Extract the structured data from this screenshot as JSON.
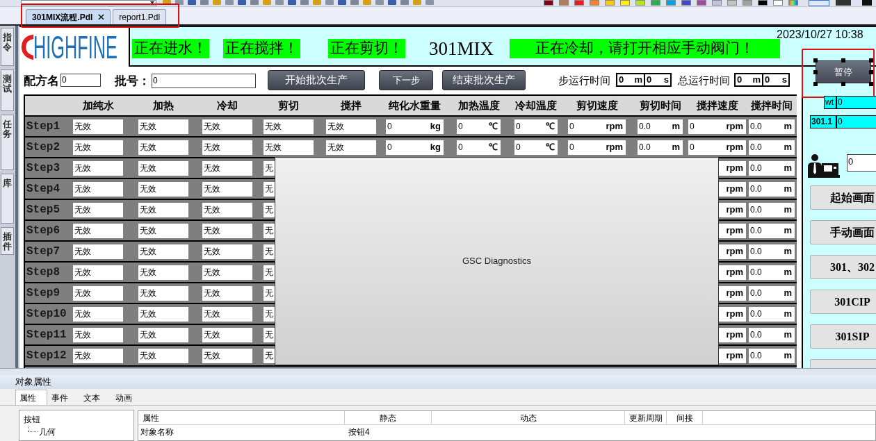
{
  "toolbar": {
    "palette": [
      {
        "color": "#880015"
      },
      {
        "color": "#b97a57"
      },
      {
        "color": "#ed1c24"
      },
      {
        "color": "#ff7f27"
      },
      {
        "color": "#ffc90e"
      },
      {
        "color": "#fff200"
      },
      {
        "color": "#b5e61d"
      },
      {
        "color": "#22b14c"
      },
      {
        "color": "#00a2e8"
      },
      {
        "color": "#3f48cc"
      },
      {
        "color": "#a349a4"
      },
      {
        "color": "#c8bfe7"
      },
      {
        "color": "#c3c3c3"
      },
      {
        "color": "#a0a0a0"
      },
      {
        "color": "#000000"
      },
      {
        "color": "#ffffff"
      }
    ]
  },
  "tabs": [
    {
      "label": "301MIX流程.Pdl",
      "closable": true,
      "selected": true
    },
    {
      "label": "report1.Pdl",
      "closable": false,
      "selected": false
    }
  ],
  "side_tabs": [
    {
      "label": "指令"
    },
    {
      "label": "测试"
    },
    {
      "label": "任务"
    },
    {
      "label": "库"
    },
    {
      "label": "插件"
    }
  ],
  "picture": {
    "logo": "HIGHFINE",
    "banner": [
      {
        "kind": "alert",
        "text": "正在进水！"
      },
      {
        "kind": "alert",
        "text": "正在搅拌！"
      },
      {
        "kind": "alert",
        "text": "正在剪切！"
      },
      {
        "kind": "title",
        "text": "301MIX"
      },
      {
        "kind": "alert",
        "text": "正在冷却，请打开相应手动阀门！"
      }
    ],
    "datetime": "2023/10/27 10:38",
    "recipe": {
      "label": "配方名",
      "value": "0"
    },
    "batch": {
      "label": "批号：",
      "value": "0"
    },
    "buttons": [
      "开始批次生产",
      "下一步",
      "结束批次生产"
    ],
    "timers": [
      {
        "label": "步运行时间",
        "minutes": "0",
        "minute_unit": "m",
        "seconds": "0",
        "second_unit": "s"
      },
      {
        "label": "总运行时间",
        "minutes": "0",
        "minute_unit": "m",
        "seconds": "0",
        "second_unit": "s"
      }
    ],
    "table": {
      "columns": [
        "加纯水",
        "加热",
        "冷却",
        "剪切",
        "搅拌",
        "纯化水重量",
        "加热温度",
        "冷却温度",
        "剪切速度",
        "剪切时间",
        "搅拌速度",
        "搅拌时间"
      ],
      "rows": [
        {
          "label": "Step1",
          "cells": [
            {
              "value": "无效"
            },
            {
              "value": "无效"
            },
            {
              "value": "无效"
            },
            {
              "value": "无效"
            },
            {
              "value": "无效"
            },
            {
              "value": "0",
              "unit": "kg"
            },
            {
              "value": "0",
              "unit": "℃"
            },
            {
              "value": "0",
              "unit": "℃"
            },
            {
              "value": "0",
              "unit": "rpm"
            },
            {
              "value": "0.0",
              "unit": "m"
            },
            {
              "value": "0",
              "unit": "rpm"
            },
            {
              "value": "0.0",
              "unit": "m"
            }
          ]
        },
        {
          "label": "Step2",
          "cells": [
            {
              "value": "无效"
            },
            {
              "value": "无效"
            },
            {
              "value": "无效"
            },
            {
              "value": "无效"
            },
            {
              "value": "无效"
            },
            {
              "value": "0",
              "unit": "kg"
            },
            {
              "value": "0",
              "unit": "℃"
            },
            {
              "value": "0",
              "unit": "℃"
            },
            {
              "value": "0",
              "unit": "rpm"
            },
            {
              "value": "0.0",
              "unit": "m"
            },
            {
              "value": "0",
              "unit": "rpm"
            },
            {
              "value": "0.0",
              "unit": "m"
            }
          ]
        },
        {
          "label": "Step3",
          "left_cells": [
            {
              "value": "无效"
            },
            {
              "value": "无效"
            },
            {
              "value": "无效"
            },
            {
              "value": "无"
            }
          ],
          "right_cells": [
            {
              "unit": "rpm"
            },
            {
              "value": "0.0",
              "unit": "m"
            }
          ]
        },
        {
          "label": "Step4",
          "left_cells": [
            {
              "value": "无效"
            },
            {
              "value": "无效"
            },
            {
              "value": "无效"
            },
            {
              "value": "无"
            }
          ],
          "right_cells": [
            {
              "unit": "rpm"
            },
            {
              "value": "0.0",
              "unit": "m"
            }
          ]
        },
        {
          "label": "Step5",
          "left_cells": [
            {
              "value": "无效"
            },
            {
              "value": "无效"
            },
            {
              "value": "无效"
            },
            {
              "value": "无"
            }
          ],
          "right_cells": [
            {
              "unit": "rpm"
            },
            {
              "value": "0.0",
              "unit": "m"
            }
          ]
        },
        {
          "label": "Step6",
          "left_cells": [
            {
              "value": "无效"
            },
            {
              "value": "无效"
            },
            {
              "value": "无效"
            },
            {
              "value": "无"
            }
          ],
          "right_cells": [
            {
              "unit": "rpm"
            },
            {
              "value": "0.0",
              "unit": "m"
            }
          ]
        },
        {
          "label": "Step7",
          "left_cells": [
            {
              "value": "无效"
            },
            {
              "value": "无效"
            },
            {
              "value": "无效"
            },
            {
              "value": "无"
            }
          ],
          "right_cells": [
            {
              "unit": "rpm"
            },
            {
              "value": "0.0",
              "unit": "m"
            }
          ]
        },
        {
          "label": "Step8",
          "left_cells": [
            {
              "value": "无效"
            },
            {
              "value": "无效"
            },
            {
              "value": "无效"
            },
            {
              "value": "无"
            }
          ],
          "right_cells": [
            {
              "unit": "rpm"
            },
            {
              "value": "0.0",
              "unit": "m"
            }
          ]
        },
        {
          "label": "Step9",
          "left_cells": [
            {
              "value": "无效"
            },
            {
              "value": "无效"
            },
            {
              "value": "无效"
            },
            {
              "value": "无"
            }
          ],
          "right_cells": [
            {
              "unit": "rpm"
            },
            {
              "value": "0.0",
              "unit": "m"
            }
          ]
        },
        {
          "label": "Step10",
          "left_cells": [
            {
              "value": "无效"
            },
            {
              "value": "无效"
            },
            {
              "value": "无效"
            },
            {
              "value": "无"
            }
          ],
          "right_cells": [
            {
              "unit": "rpm"
            },
            {
              "value": "0.0",
              "unit": "m"
            }
          ]
        },
        {
          "label": "Step11",
          "left_cells": [
            {
              "value": "无效"
            },
            {
              "value": "无效"
            },
            {
              "value": "无效"
            },
            {
              "value": "无"
            }
          ],
          "right_cells": [
            {
              "unit": "rpm"
            },
            {
              "value": "0.0",
              "unit": "m"
            }
          ]
        },
        {
          "label": "Step12",
          "left_cells": [
            {
              "value": "无效"
            },
            {
              "value": "无效"
            },
            {
              "value": "无效"
            },
            {
              "value": "无"
            }
          ],
          "right_cells": [
            {
              "unit": "rpm"
            },
            {
              "value": "0.0",
              "unit": "m"
            }
          ]
        }
      ]
    },
    "diagnostics": {
      "title": "GSC Diagnostics"
    },
    "side": {
      "pause_button": {
        "label": "暂停",
        "selected": true
      },
      "tags": [
        {
          "label": "wt",
          "value": "0"
        },
        {
          "label": "301.1",
          "value": "0"
        }
      ],
      "operator_value": "0",
      "nav_buttons": [
        "起始画面",
        "手动画面",
        "301、302",
        "301CIP",
        "301SIP"
      ]
    }
  },
  "properties_panel": {
    "title": "对象属性",
    "tabs": [
      {
        "label": "属性",
        "selected": true
      },
      {
        "label": "事件",
        "selected": false
      },
      {
        "label": "文本",
        "selected": false
      },
      {
        "label": "动画",
        "selected": false
      }
    ],
    "tree": [
      {
        "label": "按钮",
        "children": [
          {
            "label": "几何"
          }
        ]
      }
    ],
    "columns": [
      "属性",
      "静态",
      "动态",
      "更新周期",
      "间接"
    ],
    "rows": [
      {
        "property": "对象名称",
        "static": "按钮4"
      }
    ]
  }
}
